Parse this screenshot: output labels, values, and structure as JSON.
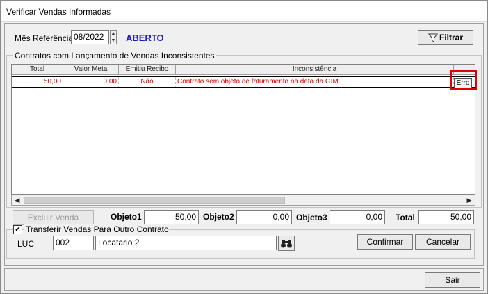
{
  "window": {
    "title": "Verificar Vendas Informadas"
  },
  "header": {
    "mes_label": "Mês Referência",
    "mes_value": "08/2022",
    "status": "ABERTO",
    "filtrar_label": "Filtrar"
  },
  "contracts_group": {
    "title": "Contratos com Lançamento de Vendas Inconsistentes"
  },
  "table": {
    "columns": [
      "Total",
      "Valor Meta",
      "Emitiu Recibo",
      "Inconsistência"
    ],
    "rows": [
      {
        "total": "50,00",
        "valor_meta": "0,00",
        "emitiu_recibo": "Não",
        "inconsistencia": "Contrato sem objeto de faturamento na data da GIM.",
        "action": "Erro"
      }
    ]
  },
  "totals": {
    "excluir_label": "Excluir Venda",
    "objeto1_label": "Objeto1",
    "objeto1_value": "50,00",
    "objeto2_label": "Objeto2",
    "objeto2_value": "0,00",
    "objeto3_label": "Objeto3",
    "objeto3_value": "0,00",
    "total_label": "Total",
    "total_value": "50,00"
  },
  "transfer": {
    "checkbox_label": "Transferir Vendas Para Outro Contrato",
    "checked": true,
    "luc_label": "LUC",
    "luc_value": "002",
    "locatario_value": "Locatario 2",
    "confirmar_label": "Confirmar",
    "cancelar_label": "Cancelar"
  },
  "footer": {
    "sair_label": "Sair"
  },
  "colors": {
    "error_text": "#e00000",
    "status": "#1a1ac8",
    "highlight": "#e00000"
  }
}
